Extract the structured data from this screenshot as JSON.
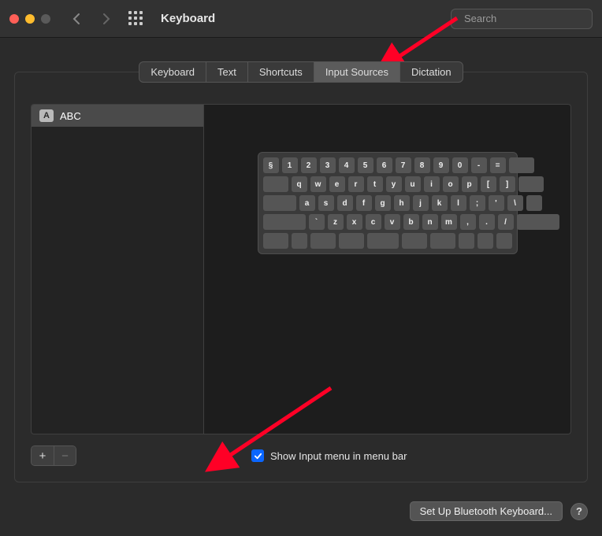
{
  "window": {
    "title": "Keyboard"
  },
  "search": {
    "placeholder": "Search"
  },
  "tabs": [
    "Keyboard",
    "Text",
    "Shortcuts",
    "Input Sources",
    "Dictation"
  ],
  "active_tab": "Input Sources",
  "sidebar": {
    "items": [
      {
        "glyph": "A",
        "label": "ABC"
      }
    ]
  },
  "keyboard_rows": [
    [
      "§",
      "1",
      "2",
      "3",
      "4",
      "5",
      "6",
      "7",
      "8",
      "9",
      "0",
      "-",
      "="
    ],
    [
      "q",
      "w",
      "e",
      "r",
      "t",
      "y",
      "u",
      "i",
      "o",
      "p",
      "[",
      "]"
    ],
    [
      "a",
      "s",
      "d",
      "f",
      "g",
      "h",
      "j",
      "k",
      "l",
      ";",
      "'",
      "\\"
    ],
    [
      "`",
      "z",
      "x",
      "c",
      "v",
      "b",
      "n",
      "m",
      ",",
      ".",
      "/"
    ]
  ],
  "checkbox": {
    "label": "Show Input menu in menu bar",
    "checked": true
  },
  "buttons": {
    "add": "+",
    "remove": "−",
    "setup": "Set Up Bluetooth Keyboard...",
    "help": "?"
  }
}
